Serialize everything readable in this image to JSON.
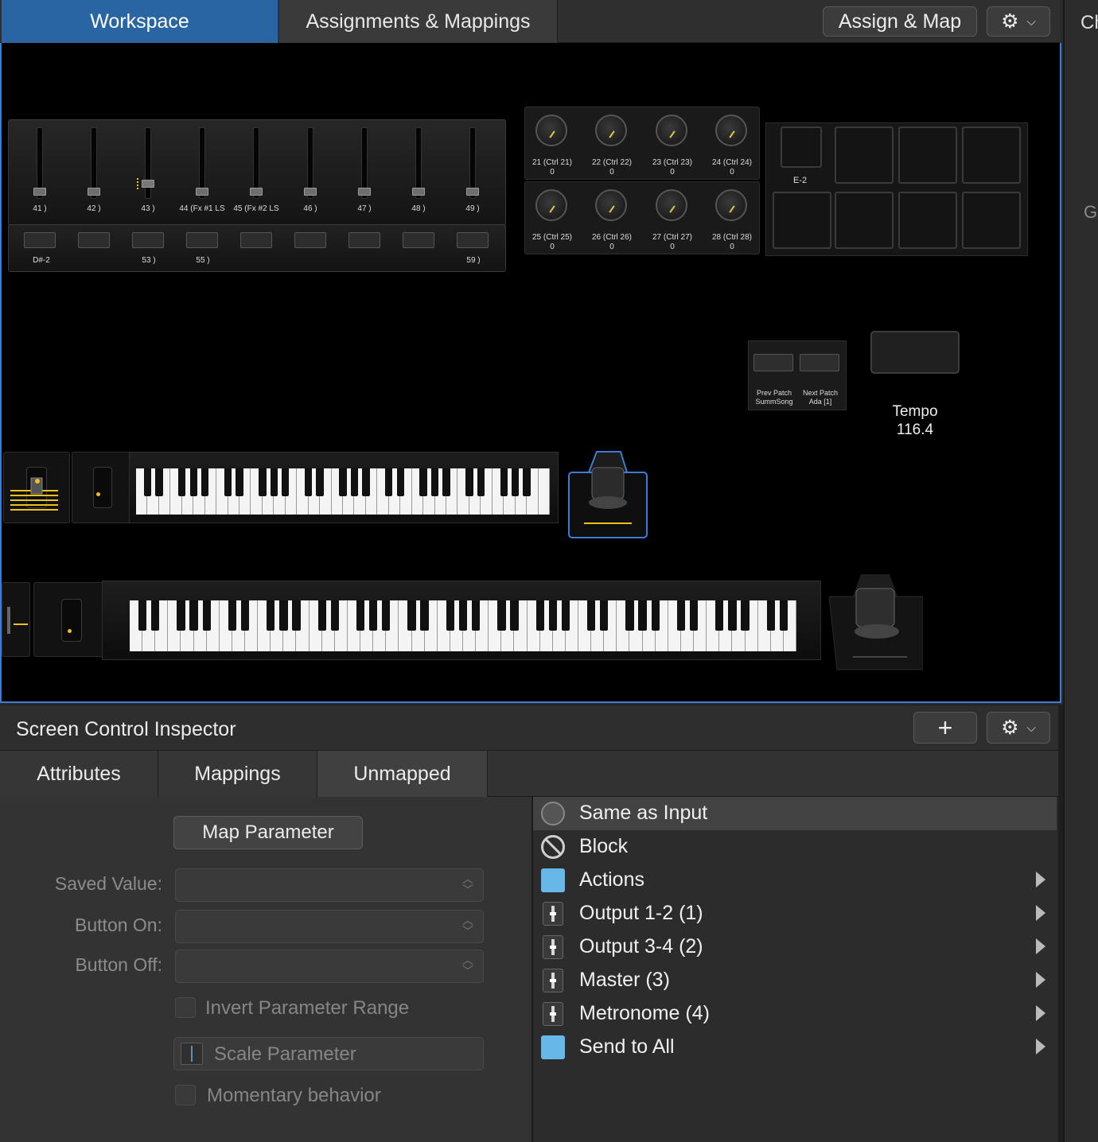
{
  "toolbar": {
    "tab_workspace": "Workspace",
    "tab_assignments": "Assignments & Mappings",
    "assign_map": "Assign & Map",
    "gear": "⚙",
    "gear_chevron": "⌵"
  },
  "right_panel": {
    "title_partial": "Ch",
    "gain_partial": "Gai"
  },
  "workspace": {
    "fader_labels": [
      "41 )",
      "42 )",
      "43 )",
      "44 (Fx #1 LS",
      "45 (Fx #2 LS",
      "46 )",
      "47 )",
      "48 )",
      "49 )"
    ],
    "button_labels": [
      "D#-2",
      "53 )",
      "55 )",
      "59 )"
    ],
    "knob_labels": [
      {
        "name": "21 (Ctrl 21)",
        "value": "0"
      },
      {
        "name": "22 (Ctrl 22)",
        "value": "0"
      },
      {
        "name": "23 (Ctrl 23)",
        "value": "0"
      },
      {
        "name": "24 (Ctrl 24)",
        "value": "0"
      },
      {
        "name": "25 (Ctrl 25)",
        "value": "0"
      },
      {
        "name": "26 (Ctrl 26)",
        "value": "0"
      },
      {
        "name": "27 (Ctrl 27)",
        "value": "0"
      },
      {
        "name": "28 (Ctrl 28)",
        "value": "0"
      }
    ],
    "pad_label": "E-2",
    "prev_patch": {
      "title": "Prev Patch",
      "value": "SummSong"
    },
    "next_patch": {
      "title": "Next Patch",
      "value": "Ada [1]"
    },
    "tempo": {
      "label": "Tempo",
      "value": "116.4"
    }
  },
  "inspector": {
    "title": "Screen Control Inspector",
    "plus": "+",
    "tabs": [
      "Attributes",
      "Mappings",
      "Unmapped"
    ],
    "map_parameter": "Map Parameter",
    "saved_value_label": "Saved Value:",
    "button_on_label": "Button On:",
    "button_off_label": "Button Off:",
    "invert_label": "Invert Parameter Range",
    "scale_label": "Scale Parameter",
    "momentary_label": "Momentary behavior"
  },
  "menu": {
    "items": [
      {
        "label": "Same as Input",
        "icon": "midi-port-icon",
        "submenu": false,
        "selected": true
      },
      {
        "label": "Block",
        "icon": "block-icon",
        "submenu": false
      },
      {
        "label": "Actions",
        "icon": "folder-icon",
        "submenu": true
      },
      {
        "label": "Output 1-2 (1)",
        "icon": "fader-icon",
        "submenu": true
      },
      {
        "label": "Output 3-4 (2)",
        "icon": "fader-icon",
        "submenu": true
      },
      {
        "label": "Master (3)",
        "icon": "fader-icon",
        "submenu": true
      },
      {
        "label": "Metronome (4)",
        "icon": "fader-icon",
        "submenu": true
      },
      {
        "label": "Send to All",
        "icon": "folder-icon",
        "submenu": true
      }
    ]
  },
  "colors": {
    "accent": "#2a65a3",
    "selection_border": "#3d7bd6",
    "indicator": "#f0c020"
  }
}
